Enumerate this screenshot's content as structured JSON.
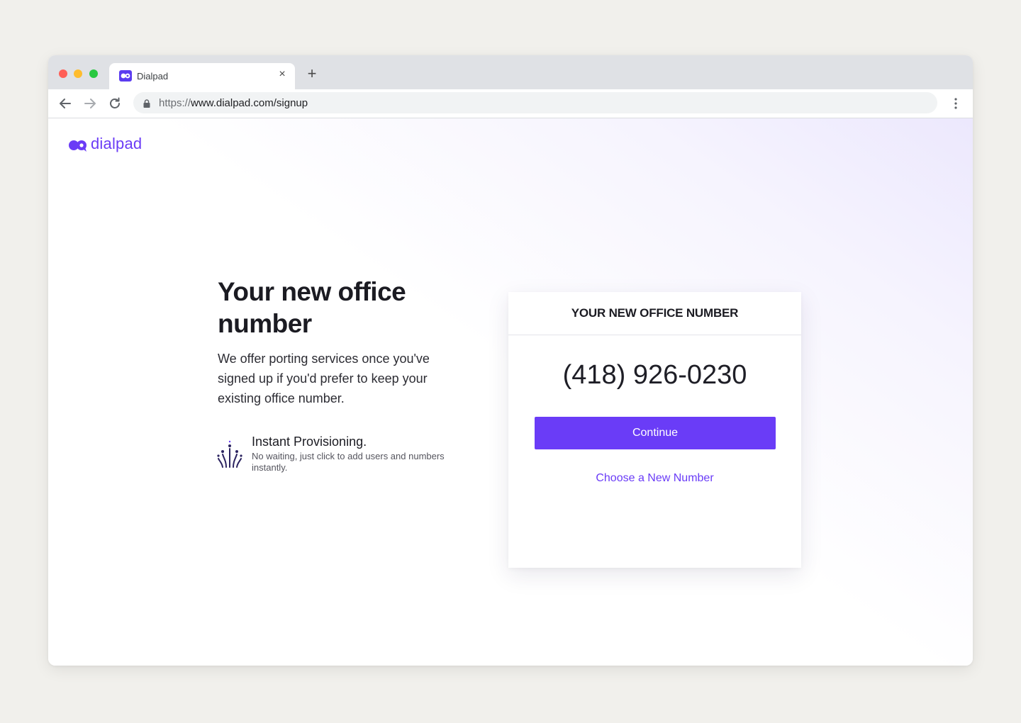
{
  "browser": {
    "tab_title": "Dialpad",
    "url_scheme": "https://",
    "url_rest": "www.dialpad.com/signup"
  },
  "logo": {
    "text": "dialpad",
    "color": "#6b3cf6"
  },
  "hero": {
    "headline": "Your new office number",
    "description": "We offer porting services once you've signed up if you'd prefer to keep your existing office number."
  },
  "feature": {
    "icon": "provisioning-icon",
    "title": "Instant Provisioning.",
    "description": "No waiting, just click to add users and numbers instantly."
  },
  "card": {
    "title": "YOUR NEW OFFICE NUMBER",
    "phone_number": "(418) 926-0230",
    "continue_label": "Continue",
    "choose_label": "Choose a New Number"
  },
  "colors": {
    "accent": "#6a3cf7",
    "window_bg": "#f1f0ec"
  }
}
